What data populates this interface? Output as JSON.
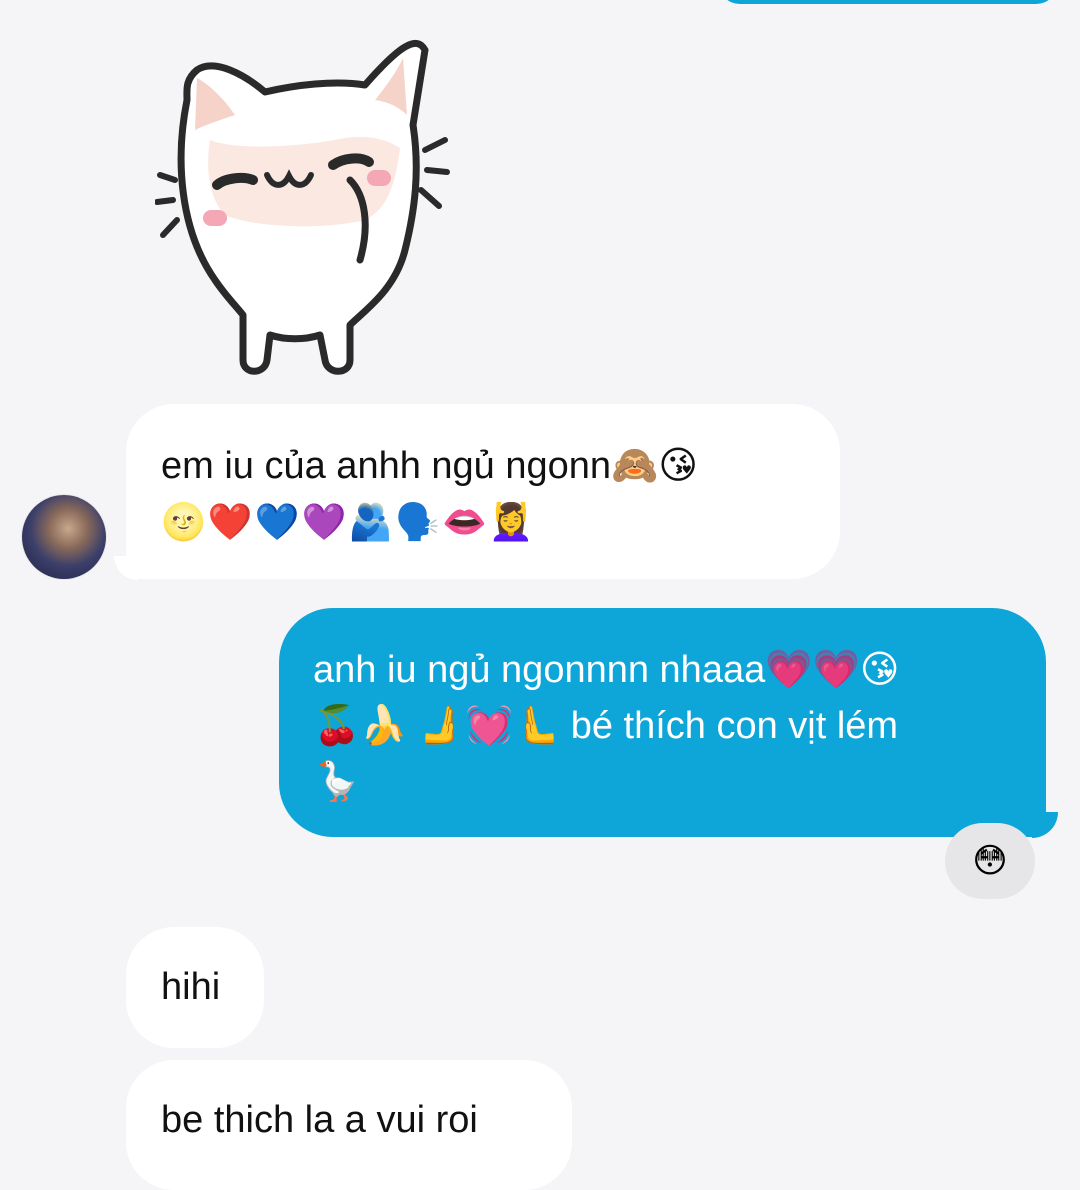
{
  "messages": [
    {
      "direction": "incoming",
      "text_line1": "em iu của anhh ngủ ngonn🙈😘",
      "text_line2": "🌝❤️💙💜🫂🗣️👄💆‍♀️"
    },
    {
      "direction": "outgoing",
      "text_line1": "anh iu ngủ ngonnnn nhaaa💗💗😘",
      "text_line2": "🍒🍌 🫸💓🫷 bé thích con vịt lém",
      "text_line3": "🪿",
      "reaction": "😳"
    },
    {
      "direction": "incoming",
      "text": "hihi"
    },
    {
      "direction": "incoming",
      "text": "be thich la a vui roi"
    }
  ],
  "sticker": {
    "description_icon": "cat-sticker-icon"
  },
  "colors": {
    "background": "#f5f5f7",
    "incoming_bubble": "#ffffff",
    "outgoing_bubble": "#0ea5d8",
    "reaction_pill": "#e6e6e8"
  }
}
